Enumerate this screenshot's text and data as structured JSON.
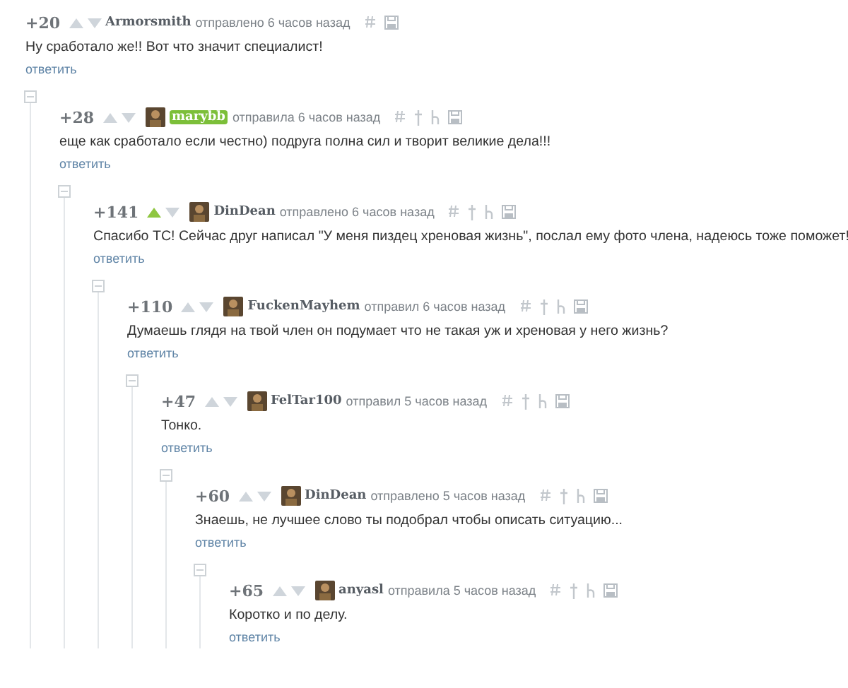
{
  "comments": [
    {
      "score": "+20",
      "upvoted": false,
      "author": "Armorsmith",
      "highlight": false,
      "avatar": false,
      "action": "отправлено 6 часов назад",
      "extra_icons": false,
      "text": "Ну сработало же!! Вот что значит специалист!",
      "reply": "ответить",
      "children": [
        {
          "score": "+28",
          "upvoted": false,
          "author": "marybb",
          "highlight": true,
          "avatar": true,
          "action": "отправила 6 часов назад",
          "extra_icons": true,
          "text": "еще как сработало если честно) подруга полна сил и творит великие дела!!!",
          "reply": "ответить",
          "children": [
            {
              "score": "+141",
              "upvoted": true,
              "author": "DinDean",
              "highlight": false,
              "avatar": true,
              "action": "отправлено 6 часов назад",
              "extra_icons": true,
              "text": "Спасибо ТС! Сейчас друг написал \"У меня пиздец хреновая жизнь\", послал ему фото члена, надеюсь тоже поможет!",
              "reply": "ответить",
              "children": [
                {
                  "score": "+110",
                  "upvoted": false,
                  "author": "FuckenMayhem",
                  "highlight": false,
                  "avatar": true,
                  "action": "отправил 6 часов назад",
                  "extra_icons": true,
                  "text": "Думаешь глядя на твой член он подумает что не такая уж и хреновая у него жизнь?",
                  "reply": "ответить",
                  "children": [
                    {
                      "score": "+47",
                      "upvoted": false,
                      "author": "FelTar100",
                      "highlight": false,
                      "avatar": true,
                      "action": "отправил 5 часов назад",
                      "extra_icons": true,
                      "text": "Тонко.",
                      "reply": "ответить",
                      "children": [
                        {
                          "score": "+60",
                          "upvoted": false,
                          "author": "DinDean",
                          "highlight": false,
                          "avatar": true,
                          "action": "отправлено 5 часов назад",
                          "extra_icons": true,
                          "text": "Знаешь, не лучшее слово ты подобрал чтобы описать ситуацию...",
                          "reply": "ответить",
                          "children": [
                            {
                              "score": "+65",
                              "upvoted": false,
                              "author": "anyasl",
                              "highlight": false,
                              "avatar": true,
                              "action": "отправила 5 часов назад",
                              "extra_icons": true,
                              "text": "Коротко и по делу.",
                              "reply": "ответить"
                            }
                          ]
                        }
                      ]
                    }
                  ]
                }
              ]
            }
          ]
        }
      ]
    }
  ]
}
